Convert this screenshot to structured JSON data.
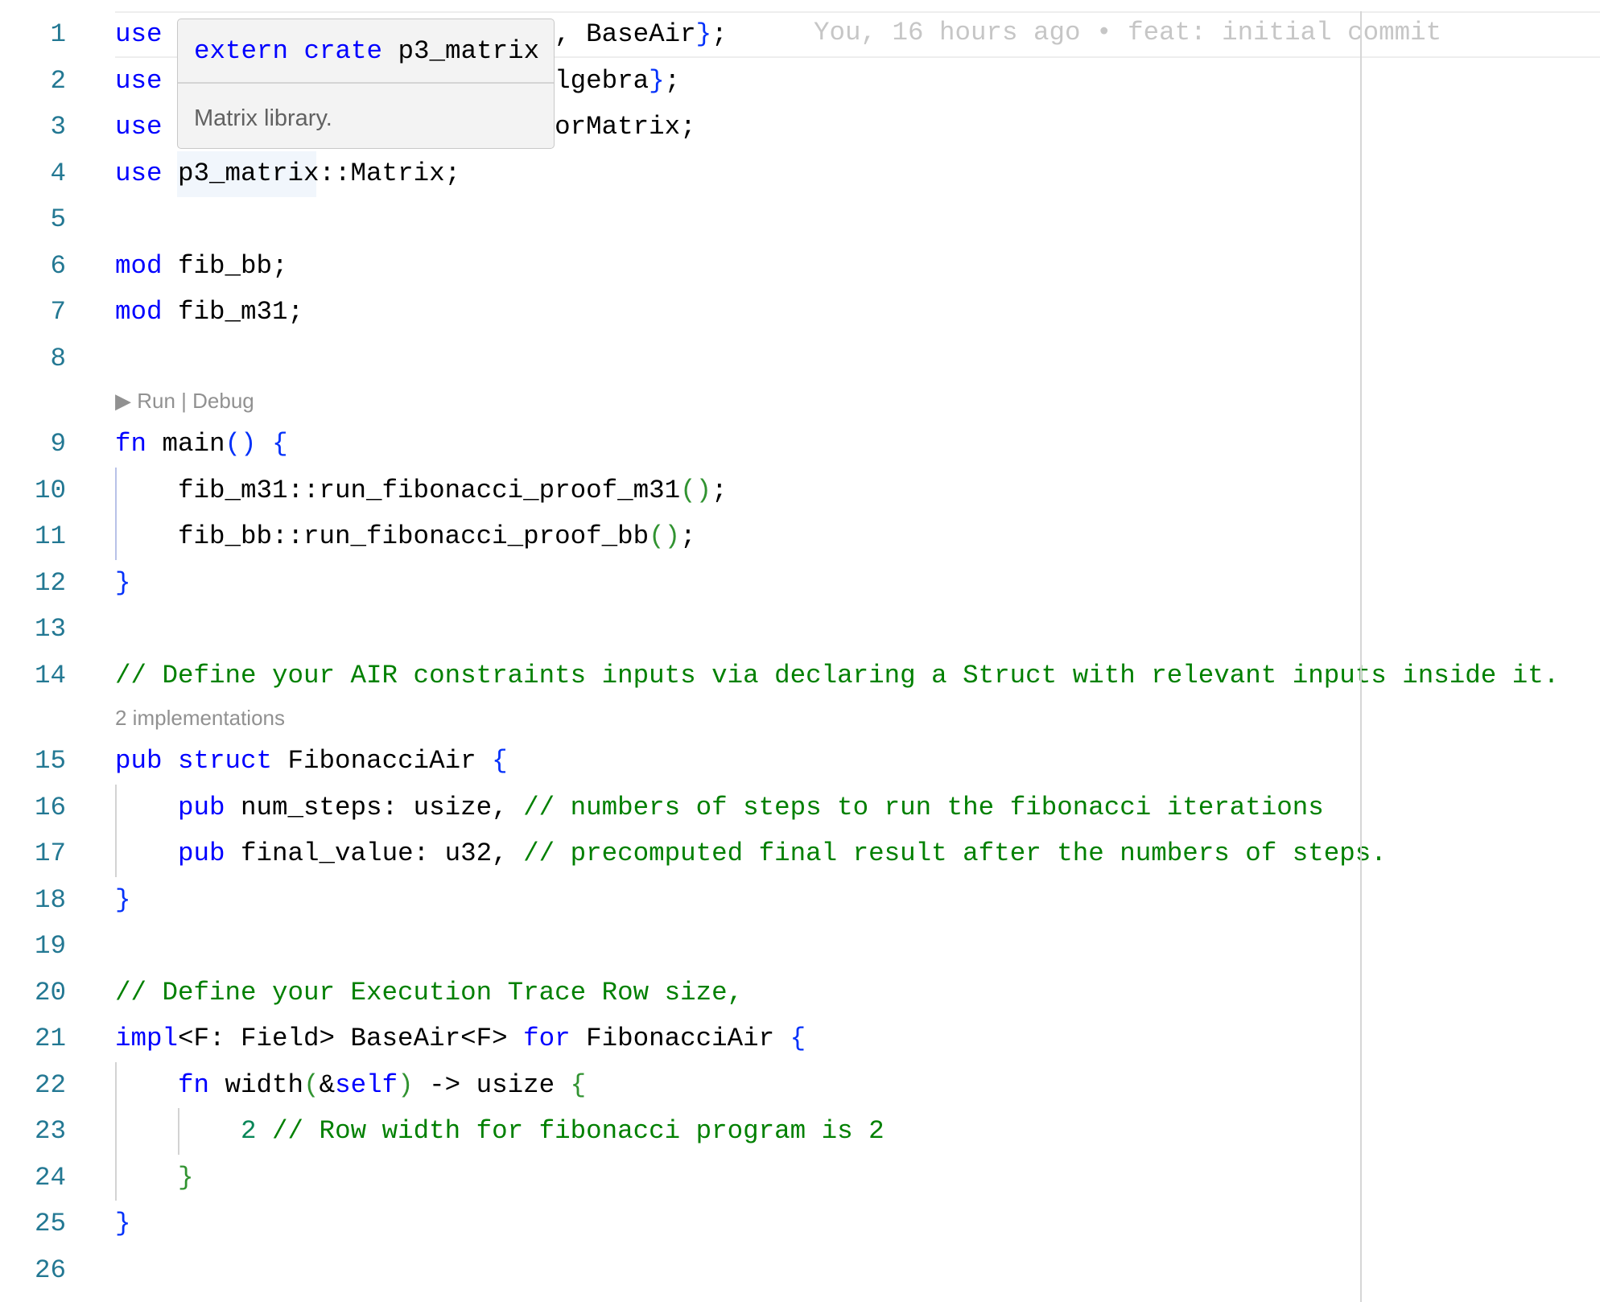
{
  "colors": {
    "keyword": "#0000ff",
    "comment": "#008000",
    "bracket1": "#0431fa",
    "bracket2": "#319331",
    "line_number": "#237893",
    "codelens": "#919191"
  },
  "blame": "You, 16 hours ago • feat: initial commit",
  "tooltip": {
    "head": [
      {
        "t": "extern crate",
        "c": "k"
      },
      {
        "t": " p3_matrix",
        "c": "t"
      }
    ],
    "body": "Matrix library."
  },
  "rows": [
    {
      "n": "1",
      "tokens": [
        {
          "t": "use",
          "c": "k"
        },
        {
          "t": "                         , BaseAir",
          "c": "t"
        },
        {
          "t": "}",
          "c": "b1"
        },
        {
          "t": ";",
          "c": "t"
        }
      ]
    },
    {
      "n": "2",
      "tokens": [
        {
          "t": "use",
          "c": "k"
        },
        {
          "t": "                         lgebra",
          "c": "t"
        },
        {
          "t": "}",
          "c": "b1"
        },
        {
          "t": ";",
          "c": "t"
        }
      ]
    },
    {
      "n": "3",
      "tokens": [
        {
          "t": "use",
          "c": "k"
        },
        {
          "t": "                         orMatrix;",
          "c": "t"
        }
      ]
    },
    {
      "n": "4",
      "tokens": [
        {
          "t": "use",
          "c": "k"
        },
        {
          "t": " p3_matrix::Matrix;",
          "c": "t"
        }
      ]
    },
    {
      "n": "5",
      "tokens": []
    },
    {
      "n": "6",
      "tokens": [
        {
          "t": "mod",
          "c": "k"
        },
        {
          "t": " fib_bb;",
          "c": "t"
        }
      ]
    },
    {
      "n": "7",
      "tokens": [
        {
          "t": "mod",
          "c": "k"
        },
        {
          "t": " fib_m31;",
          "c": "t"
        }
      ]
    },
    {
      "n": "8",
      "tokens": []
    },
    {
      "lens": "▶ Run | Debug"
    },
    {
      "n": "9",
      "tokens": [
        {
          "t": "fn",
          "c": "k"
        },
        {
          "t": " main",
          "c": "t"
        },
        {
          "t": "()",
          "c": "b1"
        },
        {
          "t": " ",
          "c": "t"
        },
        {
          "t": "{",
          "c": "b1"
        }
      ]
    },
    {
      "n": "10",
      "tokens": [
        {
          "t": "    fib_m31::run_fibonacci_proof_m31",
          "c": "t"
        },
        {
          "t": "()",
          "c": "b2"
        },
        {
          "t": ";",
          "c": "t"
        }
      ]
    },
    {
      "n": "11",
      "tokens": [
        {
          "t": "    fib_bb::run_fibonacci_proof_bb",
          "c": "t"
        },
        {
          "t": "()",
          "c": "b2"
        },
        {
          "t": ";",
          "c": "t"
        }
      ]
    },
    {
      "n": "12",
      "tokens": [
        {
          "t": "}",
          "c": "b1"
        }
      ]
    },
    {
      "n": "13",
      "tokens": []
    },
    {
      "n": "14",
      "tokens": [
        {
          "t": "// Define your AIR constraints inputs via declaring a Struct with relevant inputs inside it.",
          "c": "c"
        }
      ]
    },
    {
      "lens": "2 implementations"
    },
    {
      "n": "15",
      "tokens": [
        {
          "t": "pub struct",
          "c": "k"
        },
        {
          "t": " FibonacciAir ",
          "c": "t"
        },
        {
          "t": "{",
          "c": "b1"
        }
      ]
    },
    {
      "n": "16",
      "tokens": [
        {
          "t": "    ",
          "c": "t"
        },
        {
          "t": "pub",
          "c": "k"
        },
        {
          "t": " num_steps: usize, ",
          "c": "t"
        },
        {
          "t": "// numbers of steps to run the fibonacci iterations",
          "c": "c"
        }
      ]
    },
    {
      "n": "17",
      "tokens": [
        {
          "t": "    ",
          "c": "t"
        },
        {
          "t": "pub",
          "c": "k"
        },
        {
          "t": " final_value: u32, ",
          "c": "t"
        },
        {
          "t": "// precomputed final result after the numbers of steps.",
          "c": "c"
        }
      ]
    },
    {
      "n": "18",
      "tokens": [
        {
          "t": "}",
          "c": "b1"
        }
      ]
    },
    {
      "n": "19",
      "tokens": []
    },
    {
      "n": "20",
      "tokens": [
        {
          "t": "// Define your Execution Trace Row size,",
          "c": "c"
        }
      ]
    },
    {
      "n": "21",
      "tokens": [
        {
          "t": "impl",
          "c": "k"
        },
        {
          "t": "<F: Field> BaseAir<F> ",
          "c": "t"
        },
        {
          "t": "for",
          "c": "k"
        },
        {
          "t": " FibonacciAir ",
          "c": "t"
        },
        {
          "t": "{",
          "c": "b1"
        }
      ]
    },
    {
      "n": "22",
      "tokens": [
        {
          "t": "    ",
          "c": "t"
        },
        {
          "t": "fn",
          "c": "k"
        },
        {
          "t": " width",
          "c": "t"
        },
        {
          "t": "(",
          "c": "b2"
        },
        {
          "t": "&",
          "c": "t"
        },
        {
          "t": "self",
          "c": "k"
        },
        {
          "t": ")",
          "c": "b2"
        },
        {
          "t": " -> usize ",
          "c": "t"
        },
        {
          "t": "{",
          "c": "b2"
        }
      ]
    },
    {
      "n": "23",
      "tokens": [
        {
          "t": "        ",
          "c": "t"
        },
        {
          "t": "2",
          "c": "n"
        },
        {
          "t": " // Row width for fibonacci program is 2",
          "c": "c"
        }
      ]
    },
    {
      "n": "24",
      "tokens": [
        {
          "t": "    ",
          "c": "t"
        },
        {
          "t": "}",
          "c": "b2"
        }
      ]
    },
    {
      "n": "25",
      "tokens": [
        {
          "t": "}",
          "c": "b1"
        }
      ]
    },
    {
      "n": "26",
      "tokens": []
    }
  ]
}
